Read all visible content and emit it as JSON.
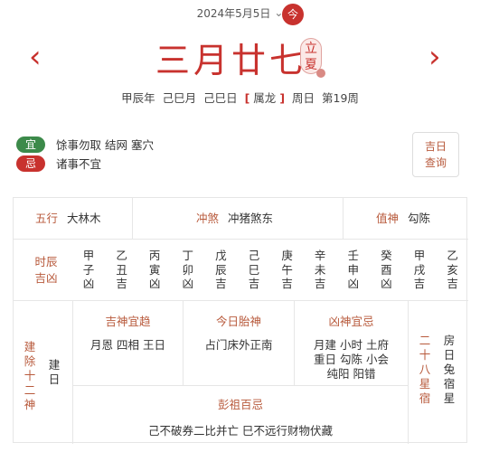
{
  "header": {
    "solar_date": "2024年5月5日",
    "today_label": "今",
    "lunar_date": "三月廿七",
    "solar_term": "立夏",
    "prev_arrow": "‹",
    "next_arrow": "›",
    "ganzhi": {
      "year": "甲辰年",
      "month": "己巳月",
      "day": "己巳日",
      "animal": "属龙",
      "weekday": "周日",
      "week": "第19周"
    }
  },
  "yiji": {
    "yi_label": "宜",
    "yi_text": "馀事勿取 结网 塞穴",
    "ji_label": "忌",
    "ji_text": "诸事不宜",
    "lucky_button": "吉日查询"
  },
  "table": {
    "wuxing": {
      "label": "五行",
      "value": "大林木"
    },
    "chongsha": {
      "label": "冲煞",
      "value": "冲猪煞东"
    },
    "zhishen": {
      "label": "值神",
      "value": "勾陈"
    },
    "shichen_label": "时辰吉凶",
    "hours": [
      {
        "ganzhi": "甲子",
        "luck": "凶"
      },
      {
        "ganzhi": "乙丑",
        "luck": "吉"
      },
      {
        "ganzhi": "丙寅",
        "luck": "凶"
      },
      {
        "ganzhi": "丁卯",
        "luck": "凶"
      },
      {
        "ganzhi": "戊辰",
        "luck": "吉"
      },
      {
        "ganzhi": "己巳",
        "luck": "吉"
      },
      {
        "ganzhi": "庚午",
        "luck": "吉"
      },
      {
        "ganzhi": "辛未",
        "luck": "吉"
      },
      {
        "ganzhi": "壬申",
        "luck": "凶"
      },
      {
        "ganzhi": "癸酉",
        "luck": "凶"
      },
      {
        "ganzhi": "甲戌",
        "luck": "吉"
      },
      {
        "ganzhi": "乙亥",
        "luck": "吉"
      }
    ],
    "jianchu": {
      "label": "建除十二神",
      "value": "建日"
    },
    "jishen": {
      "label": "吉神宜趋",
      "value": "月恩 四相 王日"
    },
    "taishen": {
      "label": "今日胎神",
      "value": "占门床外正南"
    },
    "xiongshen": {
      "label": "凶神宜忌",
      "value": "月建 小时 土府 重日 勾陈 小会 纯阳 阳错"
    },
    "pengzu": {
      "label": "彭祖百忌",
      "value": "己不破券二比并亡 巳不远行财物伏藏"
    },
    "xiu": {
      "label": "二十八星宿",
      "value": "房日兔宿星"
    }
  }
}
